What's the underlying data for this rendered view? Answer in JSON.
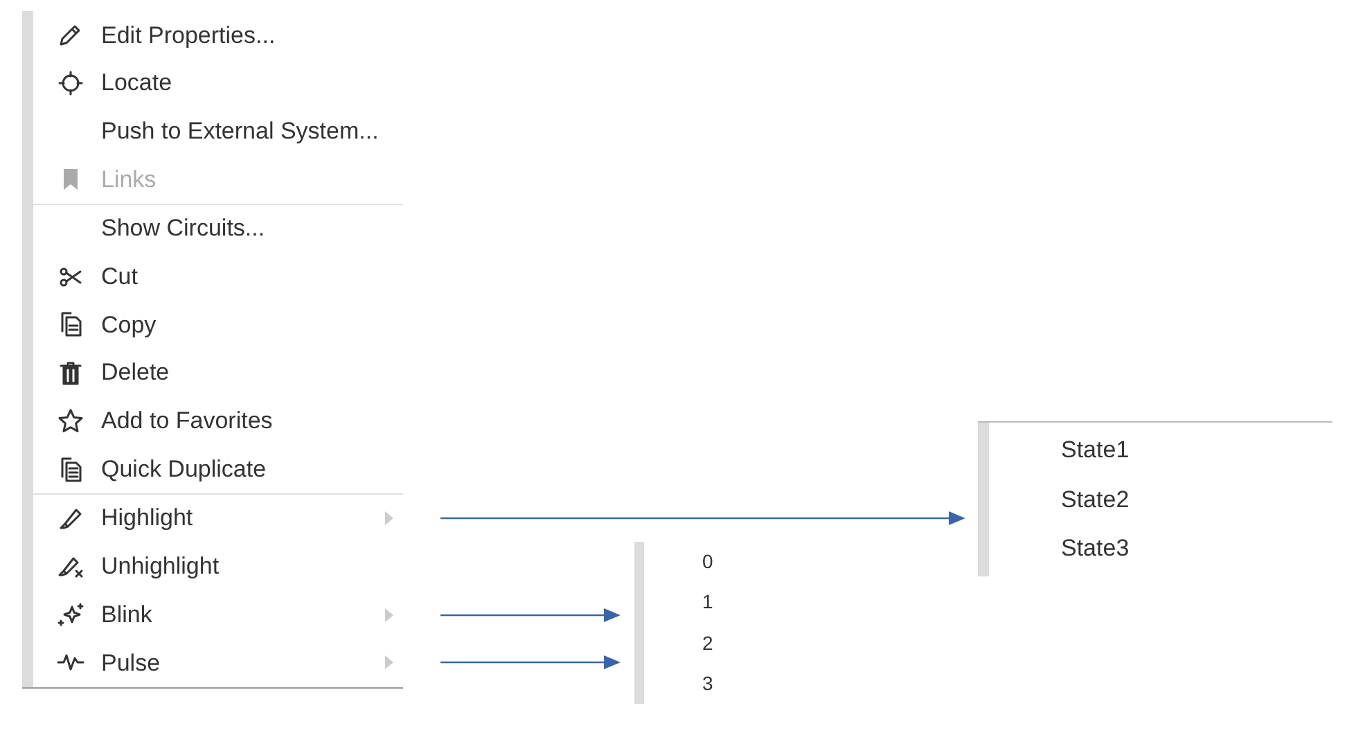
{
  "context_menu": {
    "items": [
      {
        "label": "Edit Properties...",
        "disabled": false,
        "submenu": false,
        "separator_before": false
      },
      {
        "label": "Locate",
        "disabled": false,
        "submenu": false,
        "separator_before": false
      },
      {
        "label": "Push to External System...",
        "disabled": false,
        "submenu": false,
        "separator_before": false
      },
      {
        "label": "Links",
        "disabled": true,
        "submenu": false,
        "separator_before": false
      },
      {
        "label": "Show Circuits...",
        "disabled": false,
        "submenu": false,
        "separator_before": true
      },
      {
        "label": "Cut",
        "disabled": false,
        "submenu": false,
        "separator_before": false
      },
      {
        "label": "Copy",
        "disabled": false,
        "submenu": false,
        "separator_before": false
      },
      {
        "label": "Delete",
        "disabled": false,
        "submenu": false,
        "separator_before": false
      },
      {
        "label": "Add to Favorites",
        "disabled": false,
        "submenu": false,
        "separator_before": false
      },
      {
        "label": "Quick Duplicate",
        "disabled": false,
        "submenu": false,
        "separator_before": false
      },
      {
        "label": "Highlight",
        "disabled": false,
        "submenu": true,
        "separator_before": true
      },
      {
        "label": "Unhighlight",
        "disabled": false,
        "submenu": false,
        "separator_before": false
      },
      {
        "label": "Blink",
        "disabled": false,
        "submenu": true,
        "separator_before": false
      },
      {
        "label": "Pulse",
        "disabled": false,
        "submenu": true,
        "separator_before": false
      }
    ]
  },
  "state_submenu": {
    "items": [
      "State1",
      "State2",
      "State3"
    ]
  },
  "level_submenu": {
    "items": [
      "0",
      "1",
      "2",
      "3"
    ]
  }
}
